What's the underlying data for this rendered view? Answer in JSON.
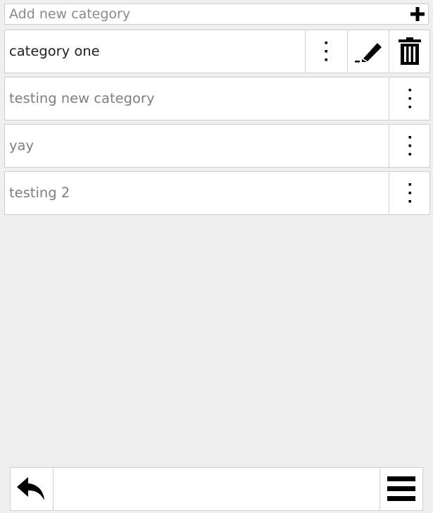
{
  "add_category": {
    "placeholder": "Add new category",
    "value": "",
    "add_icon": "plus-icon"
  },
  "categories": [
    {
      "label": "category one",
      "selected": true,
      "actions": [
        "more-vertical-icon",
        "pencil-icon",
        "trash-icon"
      ]
    },
    {
      "label": "testing new category",
      "selected": false,
      "actions": [
        "more-vertical-icon"
      ]
    },
    {
      "label": "yay",
      "selected": false,
      "actions": [
        "more-vertical-icon"
      ]
    },
    {
      "label": "testing 2",
      "selected": false,
      "actions": [
        "more-vertical-icon"
      ]
    }
  ],
  "bottom_bar": {
    "back_icon": "reply-arrow-icon",
    "menu_icon": "hamburger-menu-icon"
  },
  "colors": {
    "background": "#efefef",
    "row_background": "#ffffff",
    "border": "#cfcfcf",
    "selected_text": "#222222",
    "muted_text": "#7f7f7f",
    "icon": "#000000"
  }
}
